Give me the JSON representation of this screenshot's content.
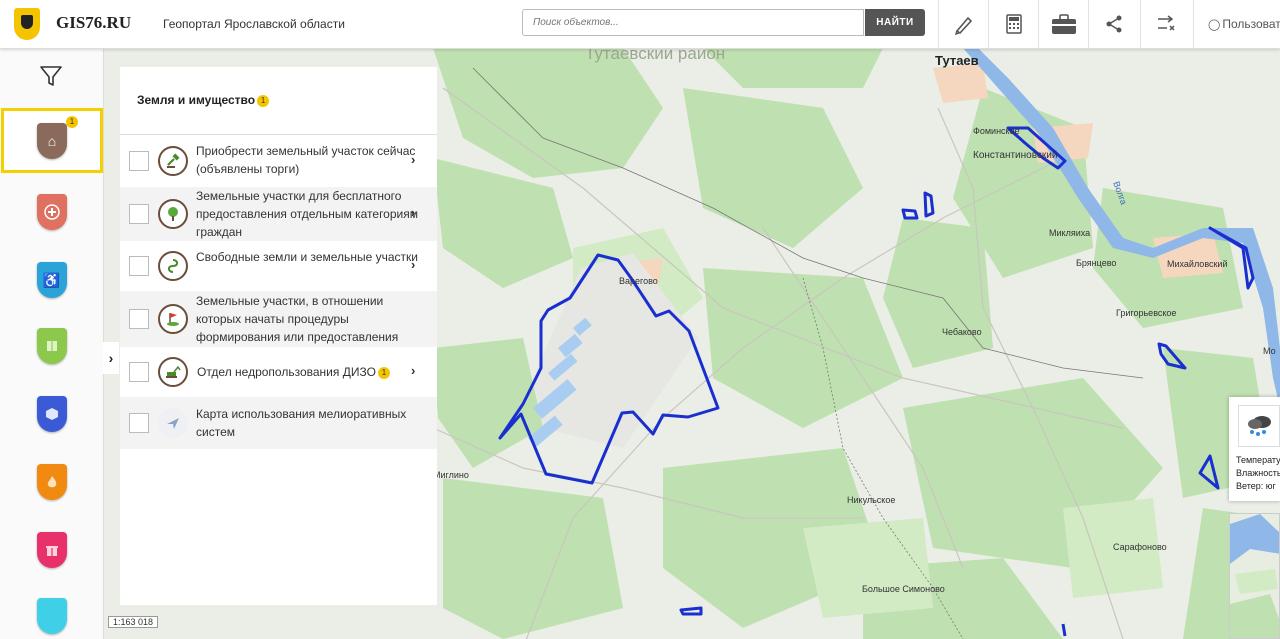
{
  "header": {
    "brand": "GIS76.RU",
    "subtitle": "Геопортал Ярославской области",
    "search_placeholder": "Поиск объектов...",
    "search_button": "НАЙТИ",
    "user_label": "Пользователь"
  },
  "panel": {
    "title": "Земля и имущество",
    "title_badge": "1",
    "layers": [
      {
        "label": "Приобрести земельный участок сейчас (объявлены торги)",
        "icon": "gavel-icon"
      },
      {
        "label": "Земельные участки для бесплатного предоставления отдельным категориям граждан",
        "icon": "tree-icon"
      },
      {
        "label": "Свободные земли и земельные участки",
        "icon": "swirl-icon"
      },
      {
        "label": "Земельные участки, в отношении которых начаты процедуры формирования или предоставления",
        "icon": "flag-icon"
      },
      {
        "label": "Отдел недропользования ДИЗО",
        "icon": "excavator-icon",
        "badge": "1"
      },
      {
        "label": "Карта использования мелиоративных систем",
        "icon": "plane-icon"
      }
    ]
  },
  "rail": {
    "active_badge": "1",
    "items": [
      {
        "name": "land-property",
        "color": "#8a6a5a",
        "icon": "house-icon"
      },
      {
        "name": "health",
        "color": "#e07060",
        "icon": "medical-cross-icon"
      },
      {
        "name": "accessibility",
        "color": "#2aa3d8",
        "icon": "wheelchair-icon"
      },
      {
        "name": "education",
        "color": "#8cc84b",
        "icon": "book-icon"
      },
      {
        "name": "objects",
        "color": "#3b5bd6",
        "icon": "cube-icon"
      },
      {
        "name": "fire",
        "color": "#f08a10",
        "icon": "flame-icon"
      },
      {
        "name": "shopping",
        "color": "#e8306a",
        "icon": "gift-icon"
      }
    ]
  },
  "map": {
    "places": [
      {
        "name": "Тутаевский район",
        "kind": "region"
      },
      {
        "name": "Тутаев",
        "kind": "big"
      },
      {
        "name": "Фоминское"
      },
      {
        "name": "Константиновский"
      },
      {
        "name": "Волга"
      },
      {
        "name": "Михайловский"
      },
      {
        "name": "Микляиха"
      },
      {
        "name": "Брянцево"
      },
      {
        "name": "Григорьевское"
      },
      {
        "name": "Чебаково"
      },
      {
        "name": "Варегово"
      },
      {
        "name": "Миглино"
      },
      {
        "name": "Никульское"
      },
      {
        "name": "Сарафоново"
      },
      {
        "name": "Большое Симоново"
      },
      {
        "name": "Мо"
      }
    ],
    "scale": "1:163 018"
  },
  "weather": {
    "lines": [
      "Температура",
      "Влажность",
      "Ветер: юг"
    ]
  },
  "colors": {
    "boundary": "#1a2fd0",
    "river": "#8fb8e8",
    "accent": "#f5d000"
  }
}
